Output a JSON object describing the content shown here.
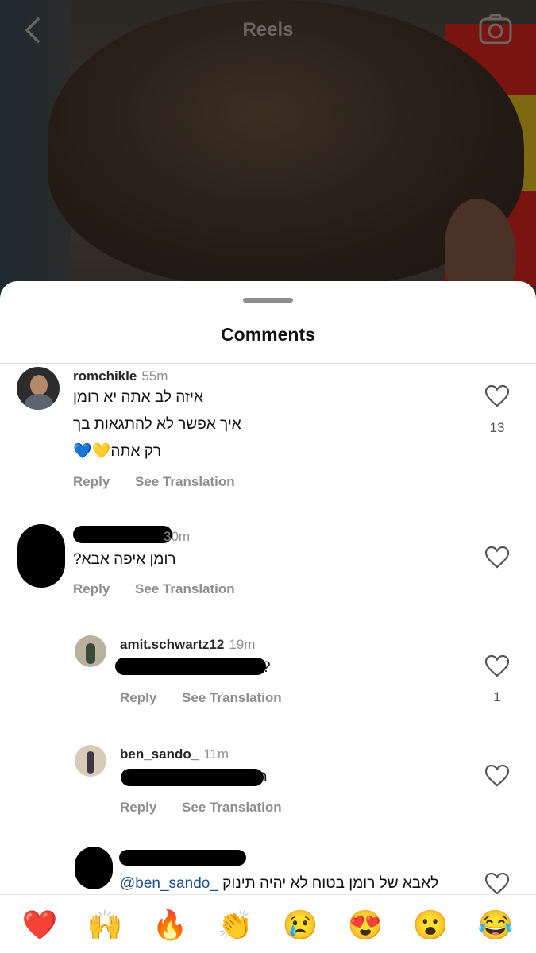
{
  "header": {
    "title": "Reels"
  },
  "sheet": {
    "title": "Comments"
  },
  "comments": [
    {
      "username": "romchikle",
      "time": "55m",
      "lines": [
        "איזה לב אתה יא רומן",
        "איך אפשר לא להתגאות בך",
        "רק אתה💛💙"
      ],
      "reply_label": "Reply",
      "translate_label": "See Translation",
      "likes": "13"
    },
    {
      "username": "",
      "time": "30m",
      "lines": [
        "רומן איפה אבא?"
      ],
      "reply_label": "Reply",
      "translate_label": "See Translation",
      "likes": ""
    },
    {
      "username": "amit.schwartz12",
      "time": "19m",
      "lines": [
        "?"
      ],
      "reply_label": "Reply",
      "translate_label": "See Translation",
      "likes": "1"
    },
    {
      "username": "ben_sando_",
      "time": "11m",
      "lines": [
        "תינוק"
      ],
      "reply_label": "Reply",
      "translate_label": "See Translation",
      "likes": ""
    },
    {
      "username": "",
      "time": "",
      "mention": "@ben_sando_",
      "lines": [
        "לאבא של רומן בטוח לא יהיה תינוק"
      ],
      "likes": ""
    }
  ],
  "emoji_bar": [
    "❤️",
    "🙌",
    "🔥",
    "👏",
    "😢",
    "😍",
    "😮",
    "😂"
  ],
  "colors": {
    "link": "#1d4f8a",
    "muted": "#8e8e8e"
  }
}
